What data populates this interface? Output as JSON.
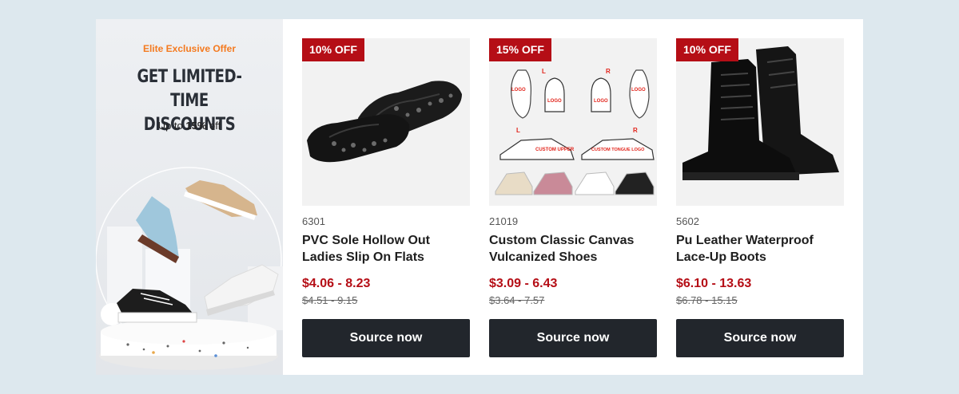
{
  "promo": {
    "eyebrow": "Elite Exclusive Offer",
    "headline_line1": "GET LIMITED-TIME",
    "headline_line2": "DISCOUNTS",
    "sub_prefix": "Up to ",
    "sub_highlight": "15%",
    "sub_suffix": " off"
  },
  "products": [
    {
      "badge": "10% OFF",
      "sku": "6301",
      "title": "PVC Sole Hollow Out Ladies Slip On Flats",
      "price": "$4.06 - 8.23",
      "old_price": "$4.51 - 9.15",
      "cta": "Source now",
      "image_icon": "black-hollow-flats-image"
    },
    {
      "badge": "15% OFF",
      "sku": "21019",
      "title": "Custom Classic Canvas Vulcanized Shoes",
      "price": "$3.09 - 6.43",
      "old_price": "$3.64 - 7.57",
      "cta": "Source now",
      "image_icon": "custom-canvas-sneaker-diagram-image",
      "diagram_labels": {
        "L": "L",
        "R": "R",
        "logo": "LOGO",
        "custom_upper": "CUSTOM UPPER",
        "custom_tongue_logo": "CUSTOM TONGUE LOGO"
      }
    },
    {
      "badge": "10% OFF",
      "sku": "5602",
      "title": "Pu Leather Waterproof Lace-Up Boots",
      "price": "$6.10 - 13.63",
      "old_price": "$6.78 - 15.15",
      "cta": "Source now",
      "image_icon": "black-leather-boots-image"
    }
  ],
  "colors": {
    "page_bg": "#dde8ee",
    "accent_orange": "#f47a1f",
    "badge_red": "#b50e16",
    "price_red": "#b50e16",
    "button_dark": "#22262c"
  }
}
